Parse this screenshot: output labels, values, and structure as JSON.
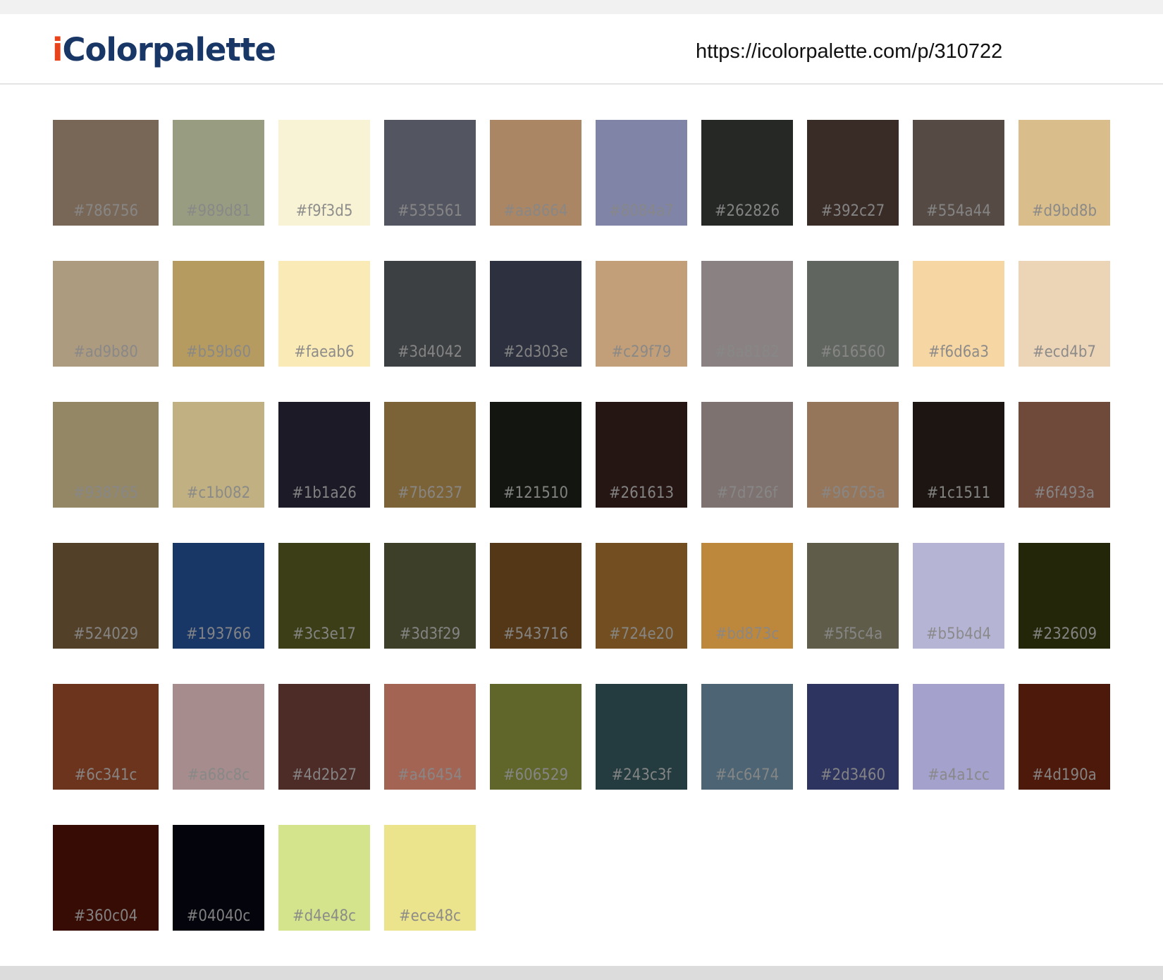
{
  "header": {
    "logo_prefix": "i",
    "logo_rest": "Colorpalette",
    "url": "https://icolorpalette.com/p/310722"
  },
  "palette": {
    "columns": 10,
    "colors": [
      "#786756",
      "#989d81",
      "#f9f3d5",
      "#535561",
      "#aa8664",
      "#8084a7",
      "#262826",
      "#392c27",
      "#554a44",
      "#d9bd8b",
      "#ad9b80",
      "#b59b60",
      "#faeab6",
      "#3d4042",
      "#2d303e",
      "#c29f79",
      "#8a8182",
      "#616560",
      "#f6d6a3",
      "#ecd4b7",
      "#938765",
      "#c1b082",
      "#1b1a26",
      "#7b6237",
      "#121510",
      "#261613",
      "#7d726f",
      "#96765a",
      "#1c1511",
      "#6f493a",
      "#524029",
      "#193766",
      "#3c3e17",
      "#3d3f29",
      "#543716",
      "#724e20",
      "#bd873c",
      "#5f5c4a",
      "#b5b4d4",
      "#232609",
      "#6c341c",
      "#a68c8c",
      "#4d2b27",
      "#a46454",
      "#606529",
      "#243c3f",
      "#4c6474",
      "#2d3460",
      "#a4a1cc",
      "#4d190a",
      "#360c04",
      "#04040c",
      "#d4e48c",
      "#ece48c"
    ]
  }
}
